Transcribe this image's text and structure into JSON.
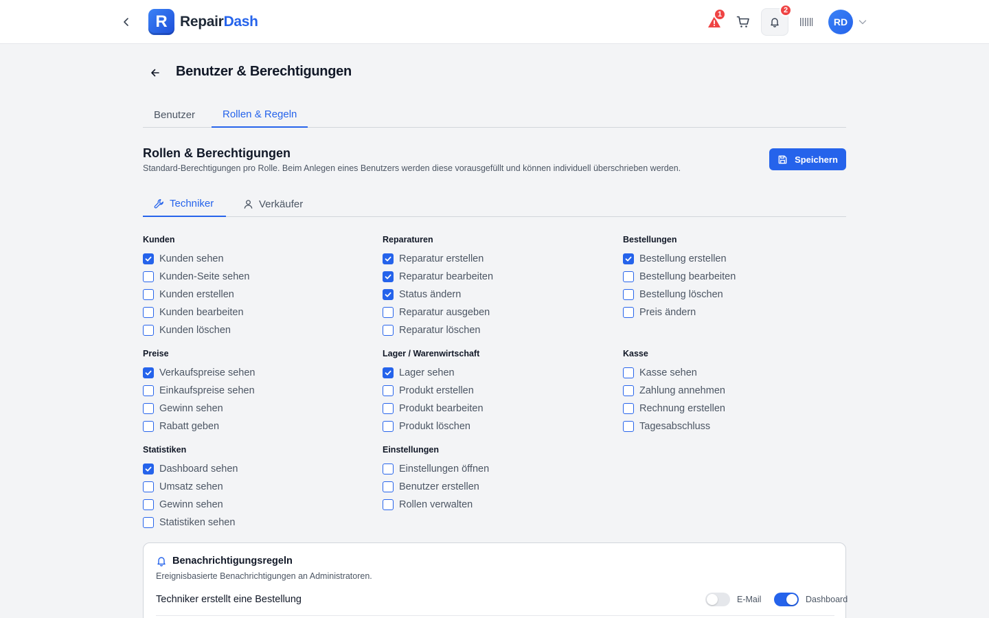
{
  "app": {
    "logo_a": "Repair",
    "logo_b": "Dash",
    "logo_letter": "R"
  },
  "topbar": {
    "alert_count": "1",
    "bell_count": "2",
    "avatar_initials": "RD"
  },
  "page": {
    "title": "Benutzer & Berechtigungen"
  },
  "main_tabs": {
    "users": "Benutzer",
    "roles": "Rollen & Regeln"
  },
  "section": {
    "title": "Rollen & Berechtigungen",
    "description": "Standard-Berechtigungen pro Rolle. Beim Anlegen eines Benutzers werden diese vorausgefüllt und können individuell überschrieben werden.",
    "save_label": "Speichern"
  },
  "role_tabs": {
    "technician": "Techniker",
    "seller": "Verkäufer"
  },
  "groups": [
    {
      "title": "Kunden",
      "items": [
        {
          "label": "Kunden sehen",
          "checked": true
        },
        {
          "label": "Kunden-Seite sehen",
          "checked": false
        },
        {
          "label": "Kunden erstellen",
          "checked": false
        },
        {
          "label": "Kunden bearbeiten",
          "checked": false
        },
        {
          "label": "Kunden löschen",
          "checked": false
        }
      ]
    },
    {
      "title": "Reparaturen",
      "items": [
        {
          "label": "Reparatur erstellen",
          "checked": true
        },
        {
          "label": "Reparatur bearbeiten",
          "checked": true
        },
        {
          "label": "Status ändern",
          "checked": true
        },
        {
          "label": "Reparatur ausgeben",
          "checked": false
        },
        {
          "label": "Reparatur löschen",
          "checked": false
        }
      ]
    },
    {
      "title": "Bestellungen",
      "items": [
        {
          "label": "Bestellung erstellen",
          "checked": true
        },
        {
          "label": "Bestellung bearbeiten",
          "checked": false
        },
        {
          "label": "Bestellung löschen",
          "checked": false
        },
        {
          "label": "Preis ändern",
          "checked": false
        }
      ]
    },
    {
      "title": "Preise",
      "items": [
        {
          "label": "Verkaufspreise sehen",
          "checked": true
        },
        {
          "label": "Einkaufspreise sehen",
          "checked": false
        },
        {
          "label": "Gewinn sehen",
          "checked": false
        },
        {
          "label": "Rabatt geben",
          "checked": false
        }
      ]
    },
    {
      "title": "Lager / Warenwirtschaft",
      "items": [
        {
          "label": "Lager sehen",
          "checked": true
        },
        {
          "label": "Produkt erstellen",
          "checked": false
        },
        {
          "label": "Produkt bearbeiten",
          "checked": false
        },
        {
          "label": "Produkt löschen",
          "checked": false
        }
      ]
    },
    {
      "title": "Kasse",
      "items": [
        {
          "label": "Kasse sehen",
          "checked": false
        },
        {
          "label": "Zahlung annehmen",
          "checked": false
        },
        {
          "label": "Rechnung erstellen",
          "checked": false
        },
        {
          "label": "Tagesabschluss",
          "checked": false
        }
      ]
    },
    {
      "title": "Statistiken",
      "items": [
        {
          "label": "Dashboard sehen",
          "checked": true
        },
        {
          "label": "Umsatz sehen",
          "checked": false
        },
        {
          "label": "Gewinn sehen",
          "checked": false
        },
        {
          "label": "Statistiken sehen",
          "checked": false
        }
      ]
    },
    {
      "title": "Einstellungen",
      "items": [
        {
          "label": "Einstellungen öffnen",
          "checked": false
        },
        {
          "label": "Benutzer erstellen",
          "checked": false
        },
        {
          "label": "Rollen verwalten",
          "checked": false
        }
      ]
    }
  ],
  "notifications": {
    "title": "Benachrichtigungsregeln",
    "description": "Ereignisbasierte Benachrichtigungen an Administratoren.",
    "rules": [
      {
        "label": "Techniker erstellt eine Bestellung",
        "email_label": "E-Mail",
        "email_on": false,
        "dashboard_label": "Dashboard",
        "dashboard_on": true
      }
    ]
  },
  "colors": {
    "primary": "#2563eb",
    "badge": "#ef4444",
    "background": "#f3f4f6"
  },
  "icons": [
    "chevron-left-icon",
    "logo-icon",
    "alert-triangle-icon",
    "cart-icon",
    "bell-icon",
    "barcode-icon",
    "chevron-down-icon",
    "arrow-left-icon",
    "save-icon",
    "wrench-icon",
    "user-icon",
    "check-icon"
  ]
}
